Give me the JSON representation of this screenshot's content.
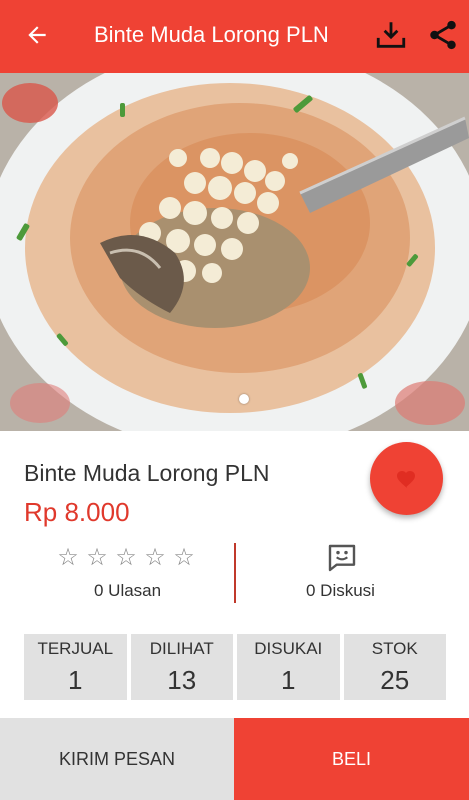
{
  "header": {
    "title": "Binte Muda Lorong PLN",
    "back_icon": "arrow-left-icon",
    "download_icon": "download-icon",
    "share_icon": "share-icon",
    "bar_color": "#ef4234"
  },
  "product": {
    "name": "Binte Muda Lorong PLN",
    "price": "Rp 8.000",
    "image_carousel": {
      "current": 1,
      "total": 1
    },
    "favorite_icon": "heart-icon"
  },
  "reviews": {
    "rating": 0,
    "max_rating": 5,
    "label": "0 Ulasan"
  },
  "discussion": {
    "icon": "chat-bubble-icon",
    "label": "0 Diskusi"
  },
  "stats": [
    {
      "label": "TERJUAL",
      "value": "1"
    },
    {
      "label": "DILIHAT",
      "value": "13"
    },
    {
      "label": "DISUKAI",
      "value": "1"
    },
    {
      "label": "STOK",
      "value": "25"
    }
  ],
  "actions": {
    "message_label": "KIRIM PESAN",
    "buy_label": "BELI"
  },
  "colors": {
    "accent": "#ef4234",
    "price": "#e0392c",
    "panel": "#e1e1e1"
  }
}
